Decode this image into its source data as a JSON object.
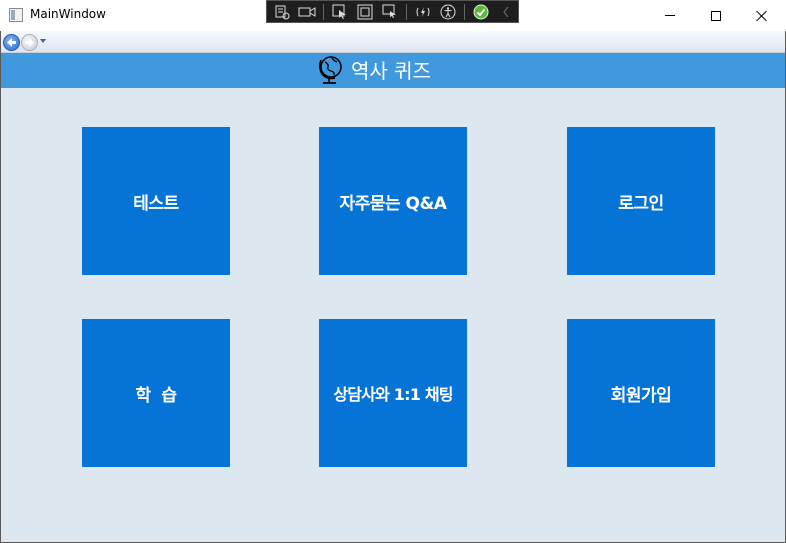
{
  "window": {
    "title": "MainWindow"
  },
  "header": {
    "title": "역사 퀴즈",
    "icon": "globe-icon",
    "background": "#4199dd"
  },
  "tiles": [
    {
      "label": "테스트"
    },
    {
      "label": "자주묻는 Q&A"
    },
    {
      "label": "로그인"
    },
    {
      "label": "학  습"
    },
    {
      "label": "상담사와 1:1 채팅"
    },
    {
      "label": "회원가입"
    }
  ],
  "colors": {
    "tile": "#0673d6",
    "page_background": "#dde7ef"
  }
}
